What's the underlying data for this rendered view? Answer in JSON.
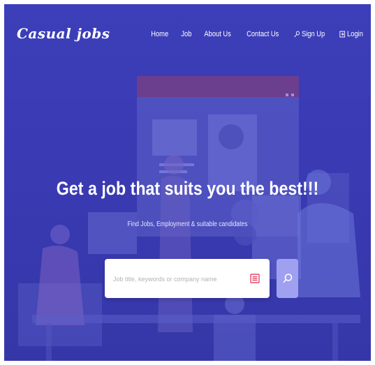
{
  "brand": {
    "name": "Casual jobs"
  },
  "nav": {
    "links": [
      {
        "label": "Home"
      },
      {
        "label": "Job"
      },
      {
        "label": "About Us"
      },
      {
        "label": "Contact Us"
      }
    ],
    "sign_up": "Sign Up",
    "login": "Login"
  },
  "hero": {
    "title": "Get a job that suits you the best!!!",
    "subtitle": "Find Jobs, Employment & suitable candidates"
  },
  "search": {
    "placeholder": "Job title, keywords or company name"
  },
  "colors": {
    "background": "#3b3db6",
    "search_button": "#9fa0f0",
    "list_icon": "#e24a6a"
  },
  "icons": {
    "sign_up": "key-icon",
    "login": "login-icon",
    "category": "list-icon",
    "search": "search-icon"
  }
}
